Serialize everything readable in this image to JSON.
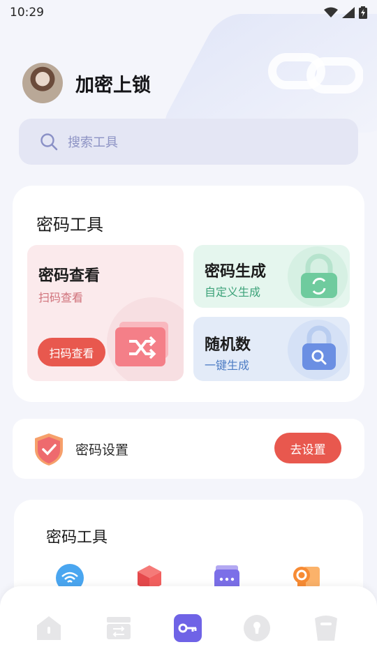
{
  "status": {
    "time": "10:29"
  },
  "profile": {
    "app_title": "加密上锁"
  },
  "search": {
    "placeholder": "搜索工具"
  },
  "password_tools": {
    "title": "密码工具",
    "view": {
      "title": "密码查看",
      "subtitle": "扫码查看",
      "button": "扫码查看"
    },
    "generate": {
      "title": "密码生成",
      "subtitle": "自定义生成"
    },
    "random": {
      "title": "随机数",
      "subtitle": "一键生成"
    }
  },
  "settings": {
    "label": "密码设置",
    "button": "去设置"
  },
  "tools_grid": {
    "title": "密码工具",
    "icons": [
      "wifi-icon",
      "cube-icon",
      "folder-icon",
      "certificate-icon"
    ]
  },
  "bottom_nav": {
    "items": [
      "home-icon",
      "archive-icon",
      "key-icon",
      "keyhole-icon",
      "cup-icon"
    ],
    "active_index": 2
  },
  "colors": {
    "accent": "#e8584e",
    "active_nav": "#6f63e6",
    "search_bg": "#e4e6f4"
  }
}
